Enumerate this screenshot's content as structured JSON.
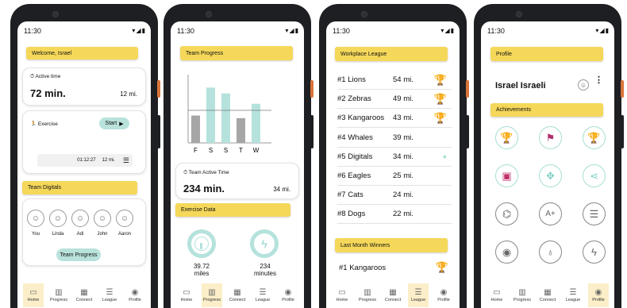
{
  "status_time": "11:30",
  "status_icons": "▾◢▮",
  "nav": [
    {
      "label": "Home",
      "icon": "▭"
    },
    {
      "label": "Progress",
      "icon": "▥"
    },
    {
      "label": "Connect",
      "icon": "▦"
    },
    {
      "label": "League",
      "icon": "☰"
    },
    {
      "label": "Profile",
      "icon": "◉"
    }
  ],
  "home": {
    "welcome": "Welcome, Israel",
    "active_time_label": "Active time",
    "active_time_value": "72 min.",
    "active_distance": "12 mi.",
    "exercise_label": "Exercise",
    "start_label": "Start",
    "exercise_time": "01:12:27",
    "exercise_distance": "12 mi.",
    "team_title": "Team Digitals",
    "members": [
      "You",
      "Linda",
      "Adi",
      "John",
      "Aaron"
    ],
    "team_progress_button": "Team Progress"
  },
  "progress": {
    "title": "Team Progress",
    "chart_data": {
      "type": "bar",
      "categories": [
        "F",
        "S",
        "S",
        "T",
        "W"
      ],
      "series": [
        {
          "values": [
            42,
            85,
            76,
            38,
            60
          ],
          "colors": [
            "#a6a6a6",
            "#b5e2dc",
            "#b5e2dc",
            "#a6a6a6",
            "#b5e2dc"
          ]
        }
      ],
      "reference_line": 50,
      "ylim": [
        0,
        100
      ],
      "title": "",
      "xlabel": "",
      "ylabel": ""
    },
    "active_time_label": "Team Active Time",
    "active_time_value": "234 min.",
    "active_distance": "34 mi.",
    "exercise_data_title": "Exercise Data",
    "miles_value": "39.72",
    "miles_unit": "miles",
    "minutes_value": "234",
    "minutes_unit": "minutes"
  },
  "league": {
    "title": "Workplace League",
    "rows": [
      {
        "rank": "#1 Lions",
        "dist": "54 mi.",
        "trophy": "🏆",
        "color": "#e8c21b"
      },
      {
        "rank": "#2 Zebras",
        "dist": "49 mi.",
        "trophy": "🏆",
        "color": "#a8a8a8"
      },
      {
        "rank": "#3 Kangaroos",
        "dist": "43 mi.",
        "trophy": "🏆",
        "color": "#b8954a"
      },
      {
        "rank": "#4 Whales",
        "dist": "39 mi.",
        "trophy": "",
        "color": ""
      },
      {
        "rank": "#5 Digitals",
        "dist": "34 mi.",
        "trophy": "●",
        "color": "#a8ded5"
      },
      {
        "rank": "#6 Eagles",
        "dist": "25 mi.",
        "trophy": "",
        "color": ""
      },
      {
        "rank": "#7 Cats",
        "dist": "24 mi.",
        "trophy": "",
        "color": ""
      },
      {
        "rank": "#8 Dogs",
        "dist": "22 mi.",
        "trophy": "",
        "color": ""
      }
    ],
    "last_month_title": "Last Month Winners",
    "last_month_winner": "#1 Kangaroos",
    "last_month_trophy": "🏆"
  },
  "profile": {
    "title": "Profile",
    "name": "Israel Israeli",
    "achievements_title": "Achievements",
    "badges": [
      {
        "icon": "🏆",
        "style": "teal",
        "color": "#e8c21b"
      },
      {
        "icon": "⚑",
        "style": "teal",
        "color": "#b0306e"
      },
      {
        "icon": "🏆",
        "style": "teal",
        "color": "#a8a8a8"
      },
      {
        "icon": "▣",
        "style": "teal",
        "color": "#c0306a"
      },
      {
        "icon": "✥",
        "style": "teal",
        "color": "#7fd1c4"
      },
      {
        "icon": "⋖",
        "style": "teal",
        "color": "#7fd1c4"
      },
      {
        "icon": "⌬",
        "style": "grey",
        "color": "#666"
      },
      {
        "icon": "A+",
        "style": "grey",
        "color": "#666"
      },
      {
        "icon": "☰",
        "style": "grey",
        "color": "#666"
      },
      {
        "icon": "◉",
        "style": "grey",
        "color": "#666"
      },
      {
        "icon": "♁",
        "style": "grey",
        "color": "#666"
      },
      {
        "icon": "ϟ",
        "style": "grey",
        "color": "#666"
      }
    ]
  }
}
